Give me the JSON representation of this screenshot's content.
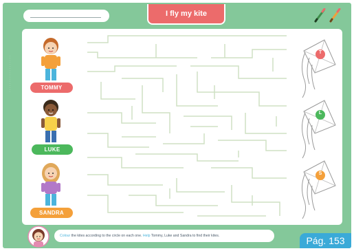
{
  "header": {
    "title": "I fly my kite"
  },
  "children": [
    {
      "name": "TOMMY",
      "initial": "T",
      "color": "#ec6b6b"
    },
    {
      "name": "LUKE",
      "initial": "L",
      "color": "#4cb85c"
    },
    {
      "name": "SANDRA",
      "initial": "S",
      "color": "#f4a03a"
    }
  ],
  "instructions": {
    "colour_word": "Colour",
    "part1": " the kites according to the circle on each one. ",
    "help_word": "Help",
    "part2": " Tommy, Luke and Sandra to find their kites."
  },
  "footer": {
    "page_label": "Pág. 153"
  },
  "colors": {
    "background": "#84c89a",
    "title_tab": "#ec6b6b",
    "page_badge": "#3aaad8",
    "maze_line": "#cfe0c4"
  }
}
